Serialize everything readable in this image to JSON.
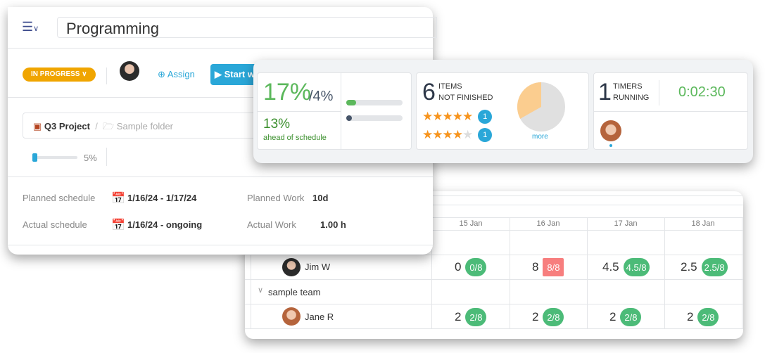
{
  "task": {
    "title": "Programming",
    "status": "IN PROGRESS",
    "assign_label": "Assign",
    "start_label": "Start w",
    "project": "Q3 Project",
    "folder": "Sample folder",
    "progress_percent": "5%",
    "progress_value": 5,
    "planned_schedule_label": "Planned schedule",
    "planned_schedule": "1/16/24 - 1/17/24",
    "actual_schedule_label": "Actual schedule",
    "actual_schedule": "1/16/24 - ongoing",
    "planned_work_label": "Planned Work",
    "planned_work": "10d",
    "actual_work_label": "Actual Work",
    "actual_work": "1.00 h"
  },
  "stats": {
    "progress_main": "17%",
    "progress_planned": "/4%",
    "ahead_value": "13%",
    "ahead_label": "ahead of schedule",
    "bars": [
      {
        "value": 17,
        "color": "#5cb85c"
      },
      {
        "value": 4,
        "color": "#475569"
      }
    ],
    "items_count": "6",
    "items_label_1": "ITEMS",
    "items_label_2": "NOT FINISHED",
    "ratings": [
      {
        "stars": 5,
        "count": "1"
      },
      {
        "stars": 4,
        "count": "1"
      }
    ],
    "pie": {
      "finished_fraction": 0.33,
      "colors": [
        "#fbcd8f",
        "#e0e0e0"
      ]
    },
    "more_label": "more",
    "timers_count": "1",
    "timers_label_1": "TIMERS",
    "timers_label_2": "RUNNING",
    "timer_value": "0:02:30"
  },
  "grid": {
    "dates": [
      "15 Jan",
      "16 Jan",
      "17 Jan",
      "18 Jan"
    ],
    "rows": [
      {
        "type": "person",
        "name": "Jim W",
        "cells": [
          {
            "v": "0",
            "p": "0/8"
          },
          {
            "v": "8",
            "p": "8/8",
            "over": true
          },
          {
            "v": "4.5",
            "p": "4.5/8"
          },
          {
            "v": "2.5",
            "p": "2.5/8"
          }
        ]
      },
      {
        "type": "team",
        "name": "sample team"
      },
      {
        "type": "person",
        "name": "Jane R",
        "cells": [
          {
            "v": "2",
            "p": "2/8"
          },
          {
            "v": "2",
            "p": "2/8"
          },
          {
            "v": "2",
            "p": "2/8"
          },
          {
            "v": "2",
            "p": "2/8"
          }
        ]
      }
    ]
  },
  "colors": {
    "accent": "#2aa7d8",
    "status": "#f0a500",
    "green": "#5cb85c",
    "over": "#f77e7e"
  }
}
